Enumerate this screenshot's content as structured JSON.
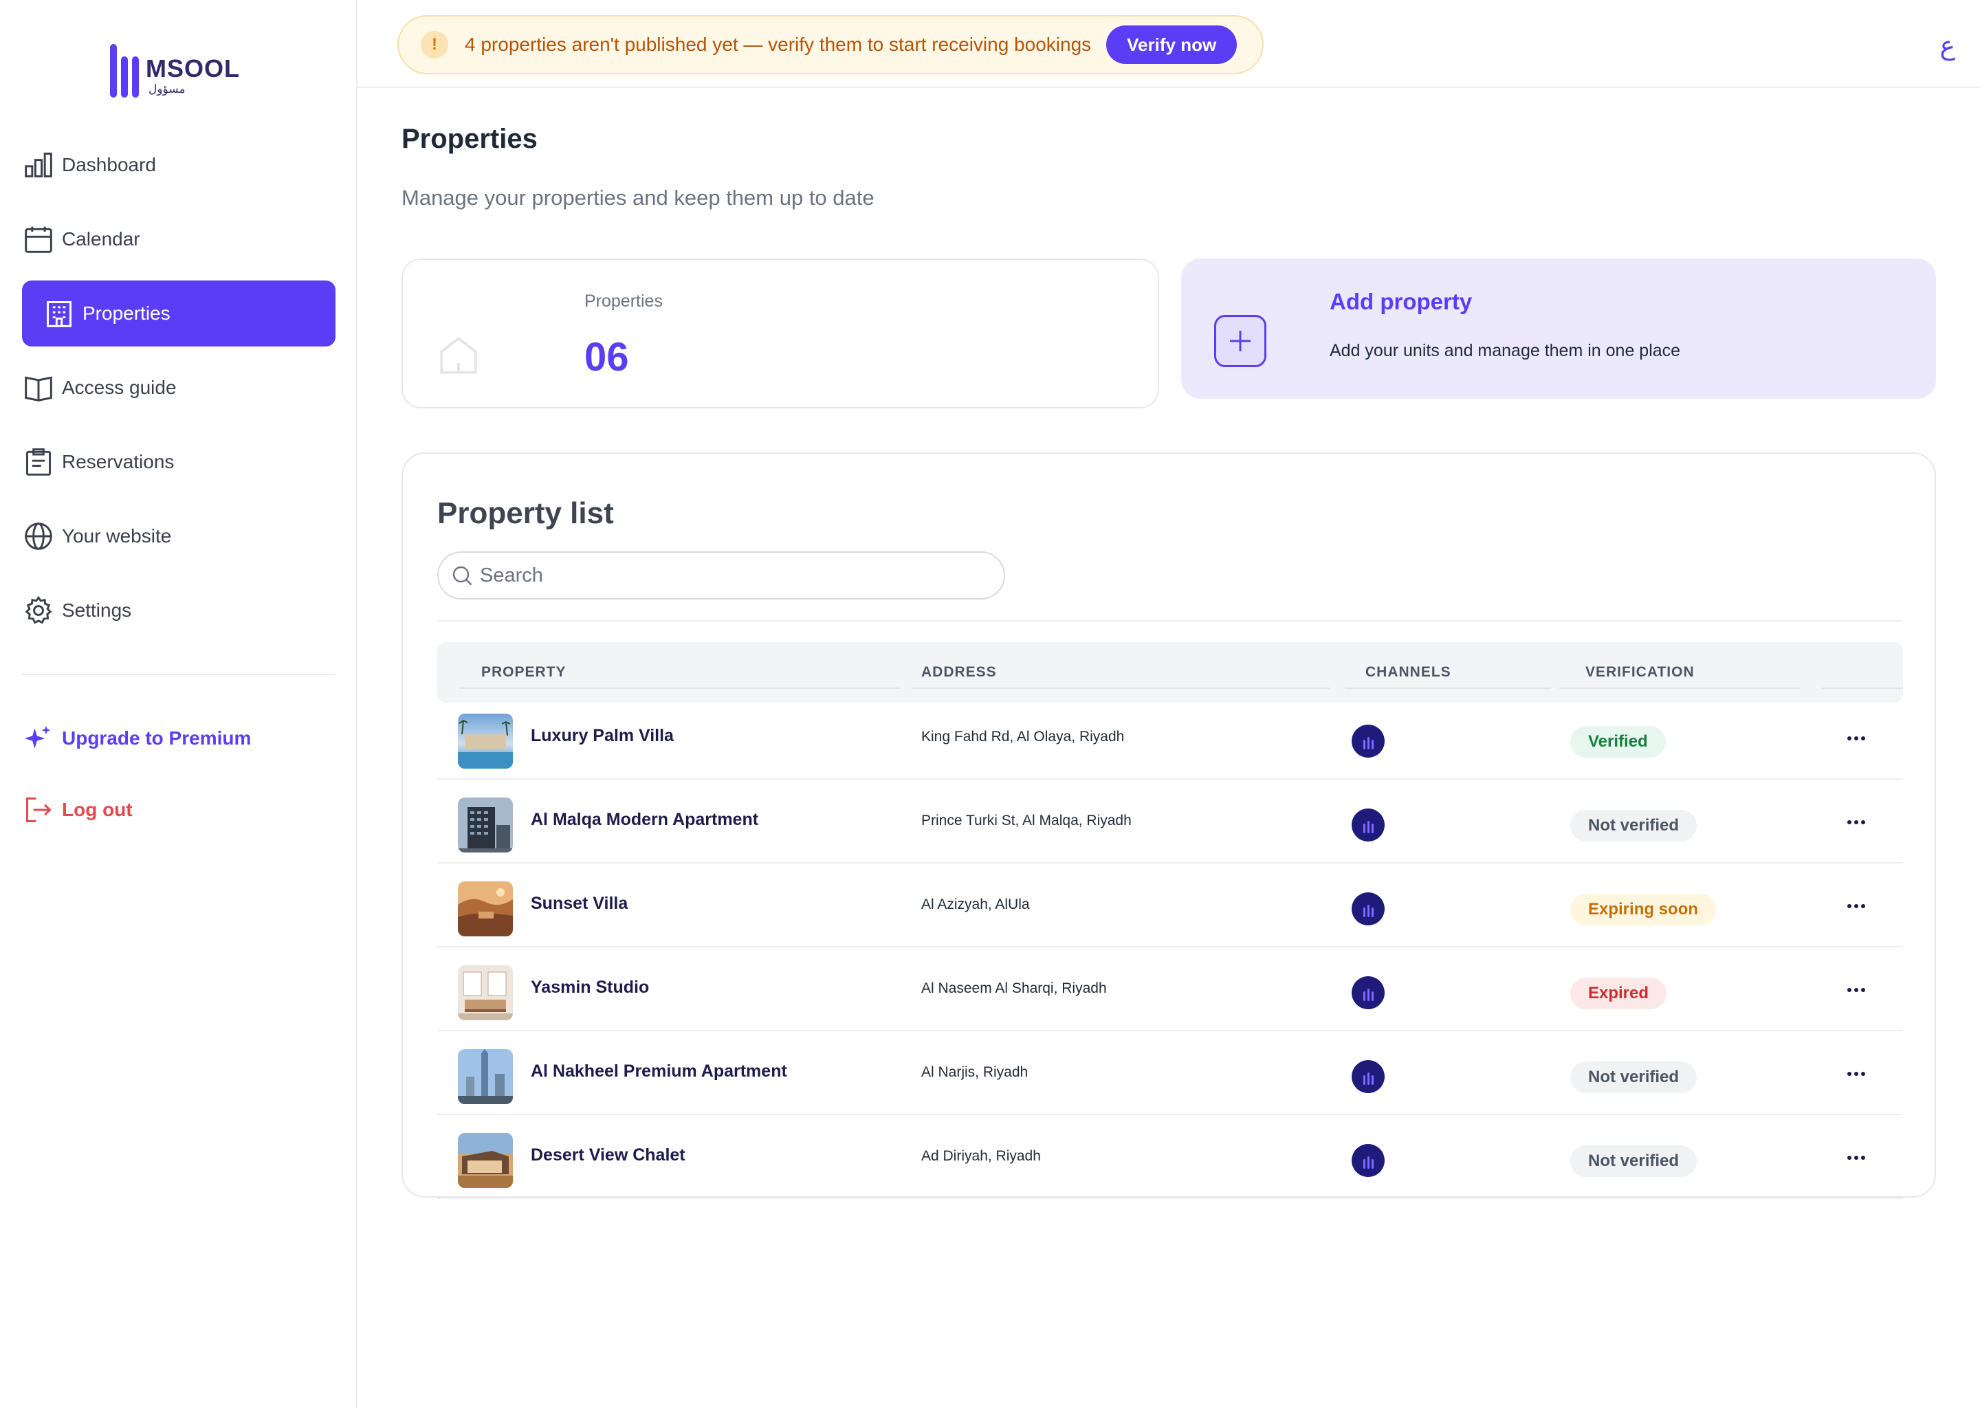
{
  "brand": {
    "name": "MSOOL",
    "sub": "مسؤول",
    "accent": "#5b3df5"
  },
  "sidebar": {
    "items": [
      {
        "label": "Dashboard",
        "icon": "bar-chart-icon",
        "active": false
      },
      {
        "label": "Calendar",
        "icon": "calendar-icon",
        "active": false
      },
      {
        "label": "Properties",
        "icon": "building-icon",
        "active": true
      },
      {
        "label": "Access guide",
        "icon": "book-icon",
        "active": false
      },
      {
        "label": "Reservations",
        "icon": "clipboard-icon",
        "active": false
      },
      {
        "label": "Your website",
        "icon": "globe-icon",
        "active": false
      },
      {
        "label": "Settings",
        "icon": "gear-icon",
        "active": false
      }
    ],
    "upgrade_label": "Upgrade to Premium",
    "logout_label": "Log out"
  },
  "banner": {
    "icon": "!",
    "message": "4 properties aren't published yet — verify them to start receiving bookings",
    "button": "Verify now"
  },
  "header": {
    "language_toggle": "ع"
  },
  "page": {
    "title": "Properties",
    "subtitle": "Manage your properties and keep them up to date"
  },
  "stats": {
    "label": "Properties",
    "value": "06"
  },
  "add_card": {
    "title": "Add property",
    "subtitle": "Add your units and manage them in one place"
  },
  "property_list": {
    "title": "Property list",
    "search_placeholder": "Search",
    "columns": [
      "PROPERTY",
      "ADDRESS",
      "CHANNELS",
      "VERIFICATION"
    ],
    "rows": [
      {
        "name": "Luxury Palm Villa",
        "address": "King Fahd Rd, Al Olaya, Riyadh",
        "status": "Verified",
        "status_kind": "verified",
        "thumb": "pool"
      },
      {
        "name": "Al Malqa Modern Apartment",
        "address": "Prince Turki St, Al Malqa, Riyadh",
        "status": "Not verified",
        "status_kind": "not",
        "thumb": "tower"
      },
      {
        "name": "Sunset Villa",
        "address": "Al Azizyah, AlUla",
        "status": "Expiring soon",
        "status_kind": "expiring",
        "thumb": "desert"
      },
      {
        "name": "Yasmin Studio",
        "address": "Al Naseem Al Sharqi, Riyadh",
        "status": "Expired",
        "status_kind": "expired",
        "thumb": "room"
      },
      {
        "name": "Al Nakheel Premium Apartment",
        "address": "Al Narjis, Riyadh",
        "status": "Not verified",
        "status_kind": "not",
        "thumb": "skyline"
      },
      {
        "name": "Desert View Chalet",
        "address": "Ad Diriyah, Riyadh",
        "status": "Not verified",
        "status_kind": "not",
        "thumb": "chalet"
      }
    ]
  },
  "status_colors": {
    "verified": {
      "bg": "#e7f7ef",
      "fg": "#15803d"
    },
    "not": {
      "bg": "#f1f2f4",
      "fg": "#4b5563"
    },
    "expiring": {
      "bg": "#fff6e0",
      "fg": "#c2700b"
    },
    "expired": {
      "bg": "#fde8e8",
      "fg": "#c53030"
    }
  }
}
